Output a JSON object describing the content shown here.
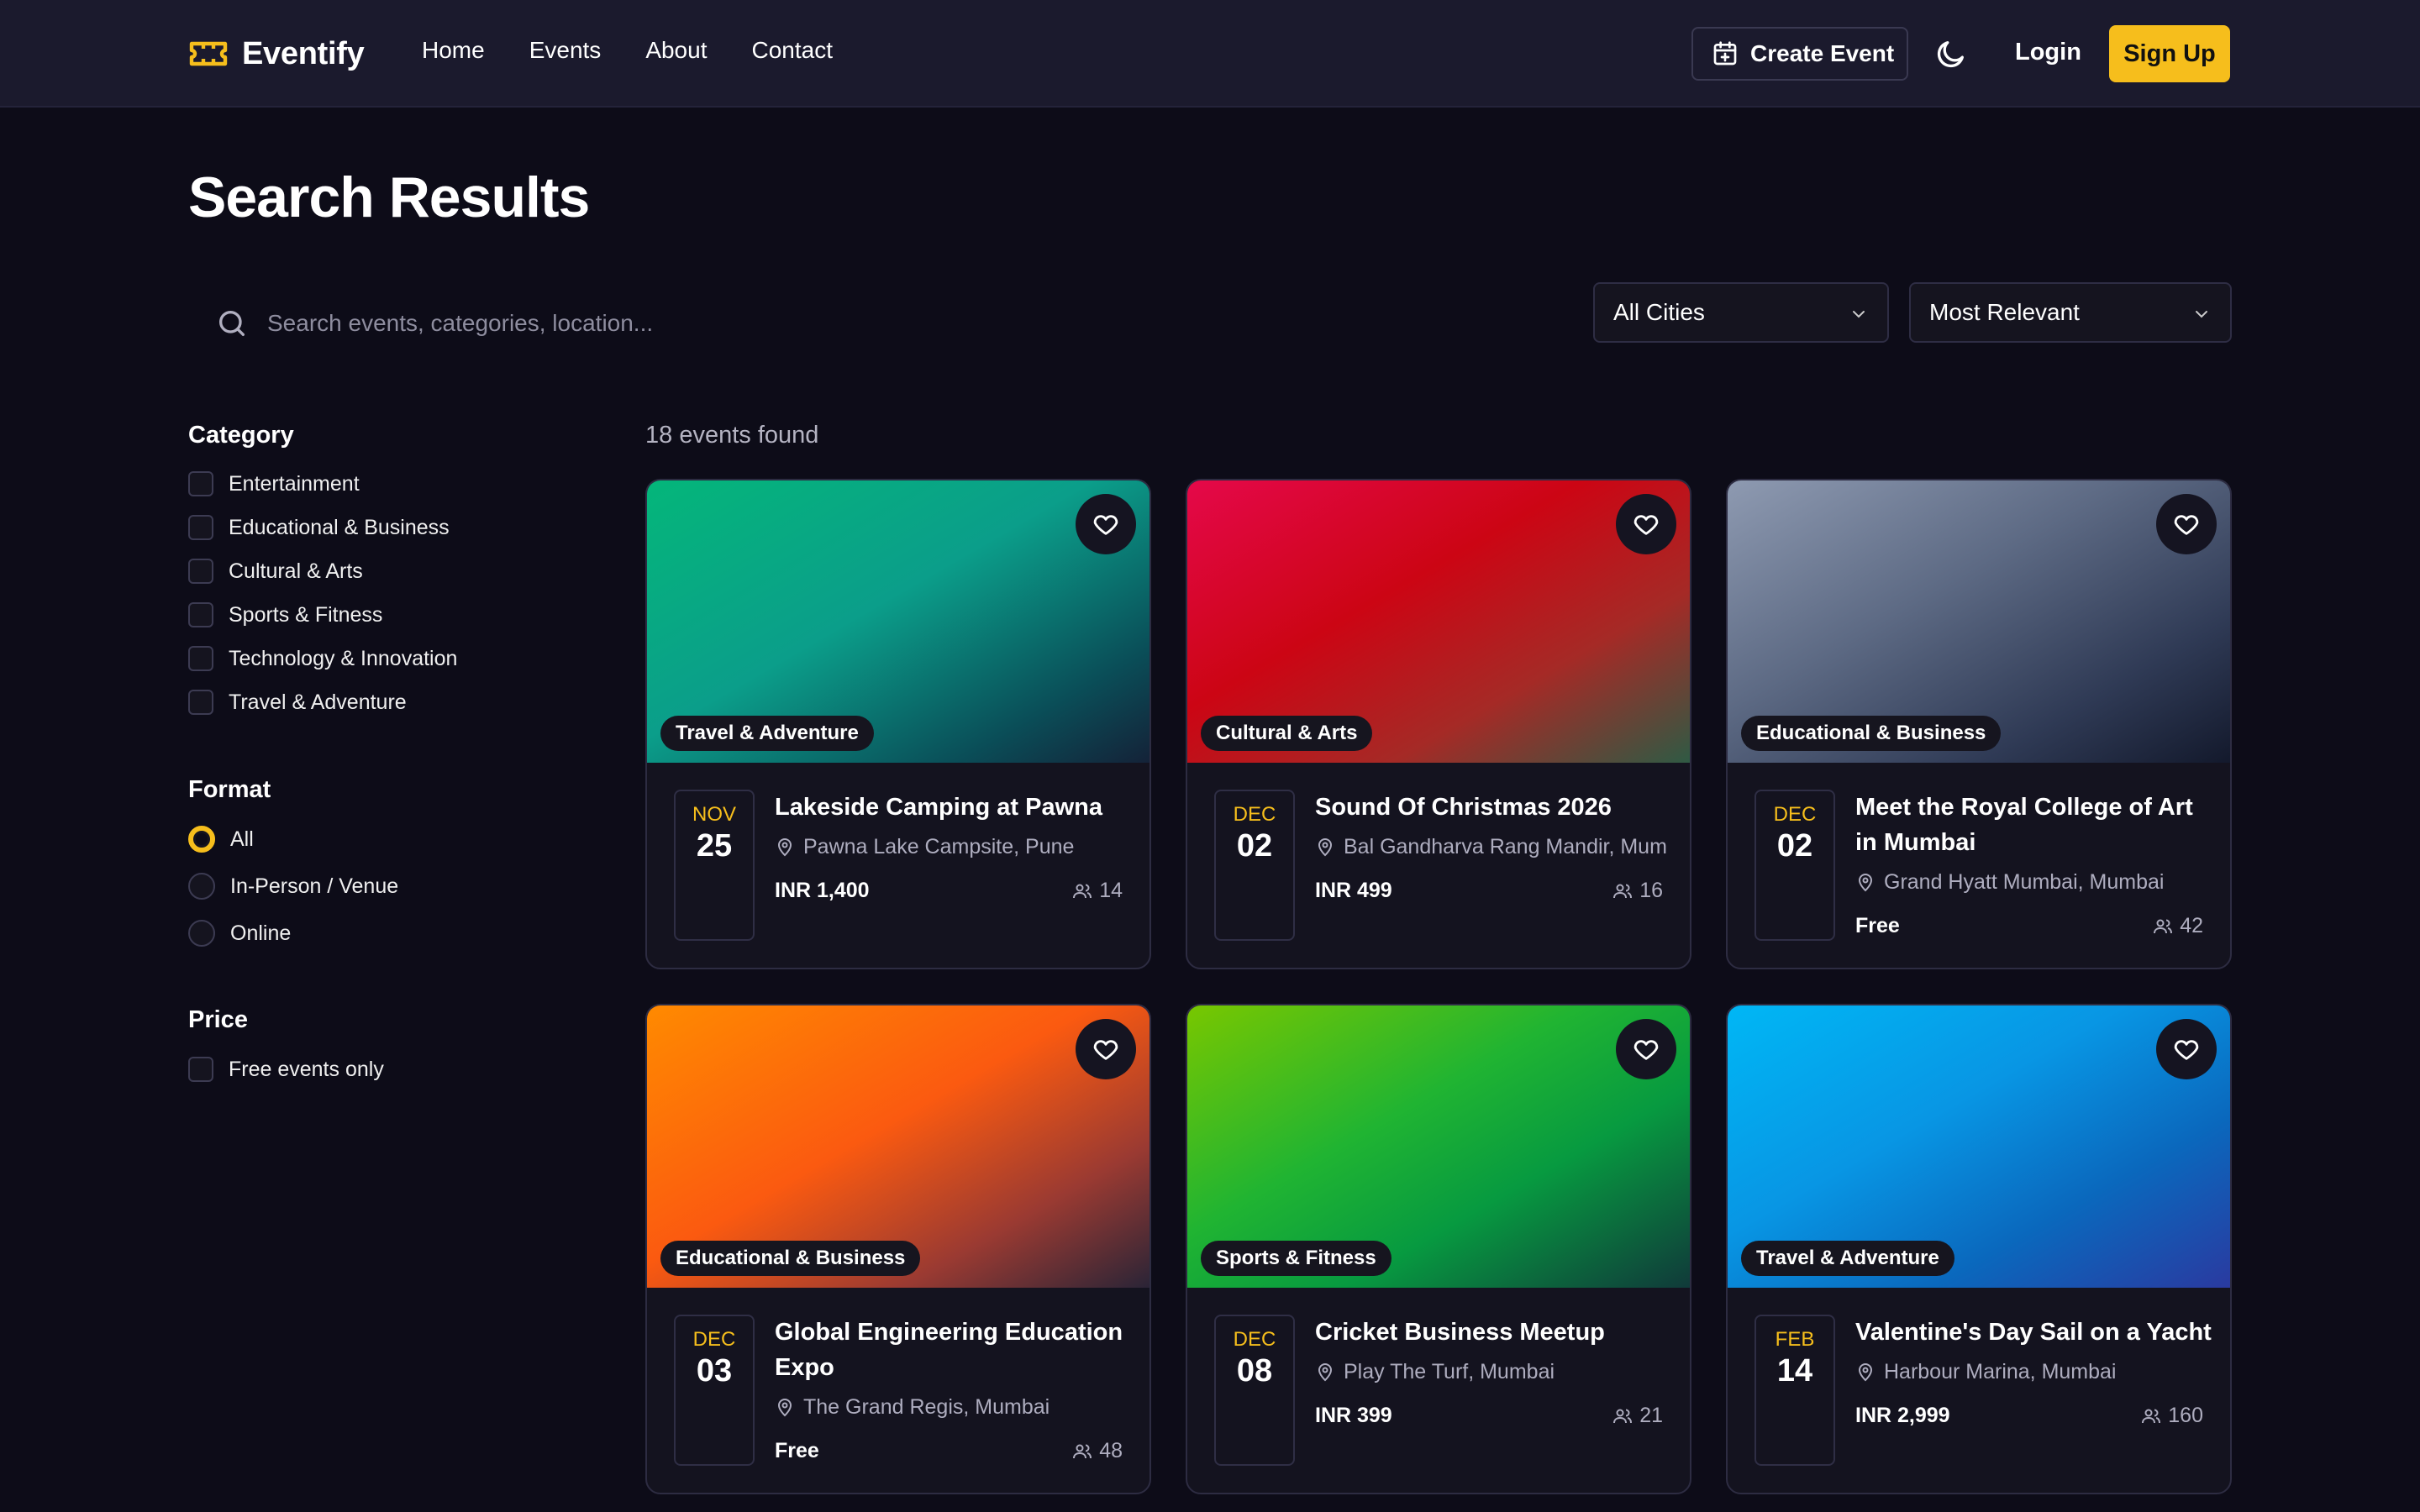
{
  "brand": "Eventify",
  "nav": {
    "links": [
      "Home",
      "Events",
      "About",
      "Contact"
    ],
    "create_event": "Create Event",
    "login": "Login",
    "signup": "Sign Up"
  },
  "page_title": "Search Results",
  "search": {
    "placeholder": "Search events, categories, location..."
  },
  "filters": {
    "city": "All Cities",
    "sort": "Most Relevant"
  },
  "sidebar": {
    "category_title": "Category",
    "categories": [
      "Entertainment",
      "Educational & Business",
      "Cultural & Arts",
      "Sports & Fitness",
      "Technology & Innovation",
      "Travel & Adventure"
    ],
    "format_title": "Format",
    "formats": [
      "All",
      "In-Person / Venue",
      "Online"
    ],
    "format_selected": "All",
    "price_title": "Price",
    "free_only": "Free events only"
  },
  "results_count": "18 events found",
  "colors": {
    "accent": "#f6be1c",
    "background": "#0d0c18",
    "nav": "#1b1a2d"
  },
  "events": [
    {
      "category": "Travel & Adventure",
      "month": "NOV",
      "day": "25",
      "title": "Lakeside Camping at Pawna",
      "location": "Pawna Lake Campsite, Pune",
      "price": "INR 1,400",
      "attendees": "14"
    },
    {
      "category": "Cultural & Arts",
      "month": "DEC",
      "day": "02",
      "title": "Sound Of Christmas 2026",
      "location": "Bal Gandharva Rang Mandir, Mum",
      "price": "INR 499",
      "attendees": "16"
    },
    {
      "category": "Educational & Business",
      "month": "DEC",
      "day": "02",
      "title": "Meet the Royal College of Art in Mumbai",
      "location": "Grand Hyatt Mumbai, Mumbai",
      "price": "Free",
      "attendees": "42"
    },
    {
      "category": "Educational & Business",
      "month": "DEC",
      "day": "03",
      "title": "Global Engineering Education Expo",
      "location": "The Grand Regis, Mumbai",
      "price": "Free",
      "attendees": "48"
    },
    {
      "category": "Sports & Fitness",
      "month": "DEC",
      "day": "08",
      "title": "Cricket Business Meetup",
      "location": "Play The Turf, Mumbai",
      "price": "INR 399",
      "attendees": "21"
    },
    {
      "category": "Travel & Adventure",
      "month": "FEB",
      "day": "14",
      "title": "Valentine's Day Sail on a Yacht",
      "location": "Harbour Marina, Mumbai",
      "price": "INR 2,999",
      "attendees": "160"
    }
  ]
}
